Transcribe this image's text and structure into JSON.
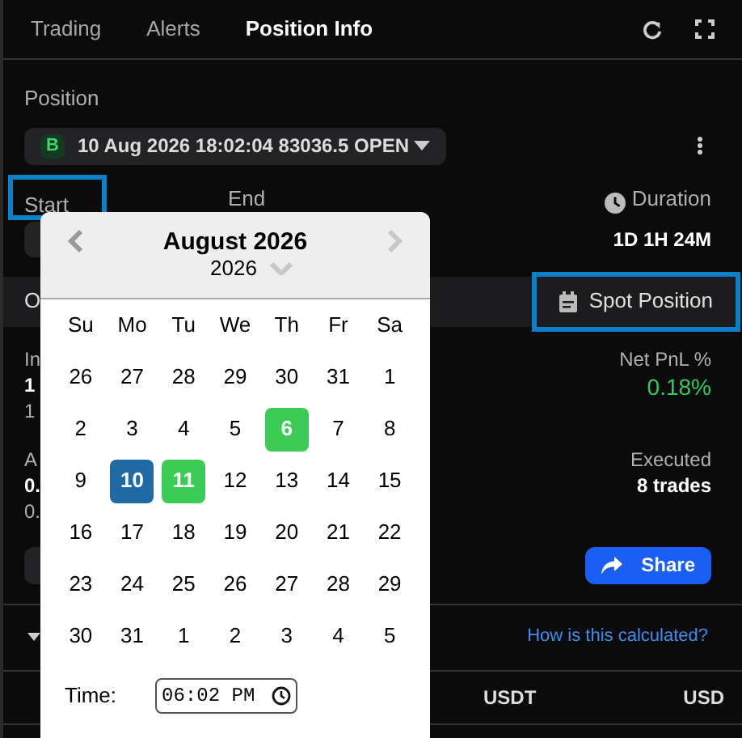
{
  "tabs": [
    {
      "label": "Trading",
      "selected": false
    },
    {
      "label": "Alerts",
      "selected": false
    },
    {
      "label": "Position Info",
      "selected": true
    }
  ],
  "position": {
    "label": "Position",
    "badge": "B",
    "value": "10 Aug 2026 18:02:04 83036.5 OPEN"
  },
  "range": {
    "start_label": "Start",
    "start_highlighted": true,
    "end_label": "End",
    "duration_label": "Duration",
    "duration_value": "1D 1H 24M"
  },
  "band": {
    "label": "O",
    "spot_button": "Spot Position",
    "spot_highlighted": true
  },
  "stats_left": [
    {
      "label": "In",
      "value": "1",
      "sub": "1"
    },
    {
      "label": "A",
      "value": "0.",
      "sub": "0."
    }
  ],
  "stats_right": [
    {
      "label": "Net PnL %",
      "value": "0.18%",
      "positive": true
    },
    {
      "label": "Executed",
      "value": "8 trades",
      "positive": false
    }
  ],
  "share_button": "Share",
  "help_link": "How is this calculated?",
  "table": {
    "columns": [
      "USDT",
      "USD"
    ]
  },
  "calendar": {
    "month": "August 2026",
    "year": "2026",
    "weekdays": [
      "Su",
      "Mo",
      "Tu",
      "We",
      "Th",
      "Fr",
      "Sa"
    ],
    "weeks": [
      [
        {
          "day": "26",
          "selected": false,
          "marked": false
        },
        {
          "day": "27",
          "selected": false,
          "marked": false
        },
        {
          "day": "28",
          "selected": false,
          "marked": false
        },
        {
          "day": "29",
          "selected": false,
          "marked": false
        },
        {
          "day": "30",
          "selected": false,
          "marked": false
        },
        {
          "day": "31",
          "selected": false,
          "marked": false
        },
        {
          "day": "1",
          "selected": false,
          "marked": false
        }
      ],
      [
        {
          "day": "2",
          "selected": false,
          "marked": false
        },
        {
          "day": "3",
          "selected": false,
          "marked": false
        },
        {
          "day": "4",
          "selected": false,
          "marked": false
        },
        {
          "day": "5",
          "selected": false,
          "marked": false
        },
        {
          "day": "6",
          "selected": false,
          "marked": true
        },
        {
          "day": "7",
          "selected": false,
          "marked": false
        },
        {
          "day": "8",
          "selected": false,
          "marked": false
        }
      ],
      [
        {
          "day": "9",
          "selected": false,
          "marked": false
        },
        {
          "day": "10",
          "selected": true,
          "marked": false
        },
        {
          "day": "11",
          "selected": false,
          "marked": true
        },
        {
          "day": "12",
          "selected": false,
          "marked": false
        },
        {
          "day": "13",
          "selected": false,
          "marked": false
        },
        {
          "day": "14",
          "selected": false,
          "marked": false
        },
        {
          "day": "15",
          "selected": false,
          "marked": false
        }
      ],
      [
        {
          "day": "16",
          "selected": false,
          "marked": false
        },
        {
          "day": "17",
          "selected": false,
          "marked": false
        },
        {
          "day": "18",
          "selected": false,
          "marked": false
        },
        {
          "day": "19",
          "selected": false,
          "marked": false
        },
        {
          "day": "20",
          "selected": false,
          "marked": false
        },
        {
          "day": "21",
          "selected": false,
          "marked": false
        },
        {
          "day": "22",
          "selected": false,
          "marked": false
        }
      ],
      [
        {
          "day": "23",
          "selected": false,
          "marked": false
        },
        {
          "day": "24",
          "selected": false,
          "marked": false
        },
        {
          "day": "25",
          "selected": false,
          "marked": false
        },
        {
          "day": "26",
          "selected": false,
          "marked": false
        },
        {
          "day": "27",
          "selected": false,
          "marked": false
        },
        {
          "day": "28",
          "selected": false,
          "marked": false
        },
        {
          "day": "29",
          "selected": false,
          "marked": false
        }
      ],
      [
        {
          "day": "30",
          "selected": false,
          "marked": false
        },
        {
          "day": "31",
          "selected": false,
          "marked": false
        },
        {
          "day": "1",
          "selected": false,
          "marked": false
        },
        {
          "day": "2",
          "selected": false,
          "marked": false
        },
        {
          "day": "3",
          "selected": false,
          "marked": false
        },
        {
          "day": "4",
          "selected": false,
          "marked": false
        },
        {
          "day": "5",
          "selected": false,
          "marked": false
        }
      ]
    ],
    "time_label": "Time:",
    "time_value": "06:02 PM"
  }
}
